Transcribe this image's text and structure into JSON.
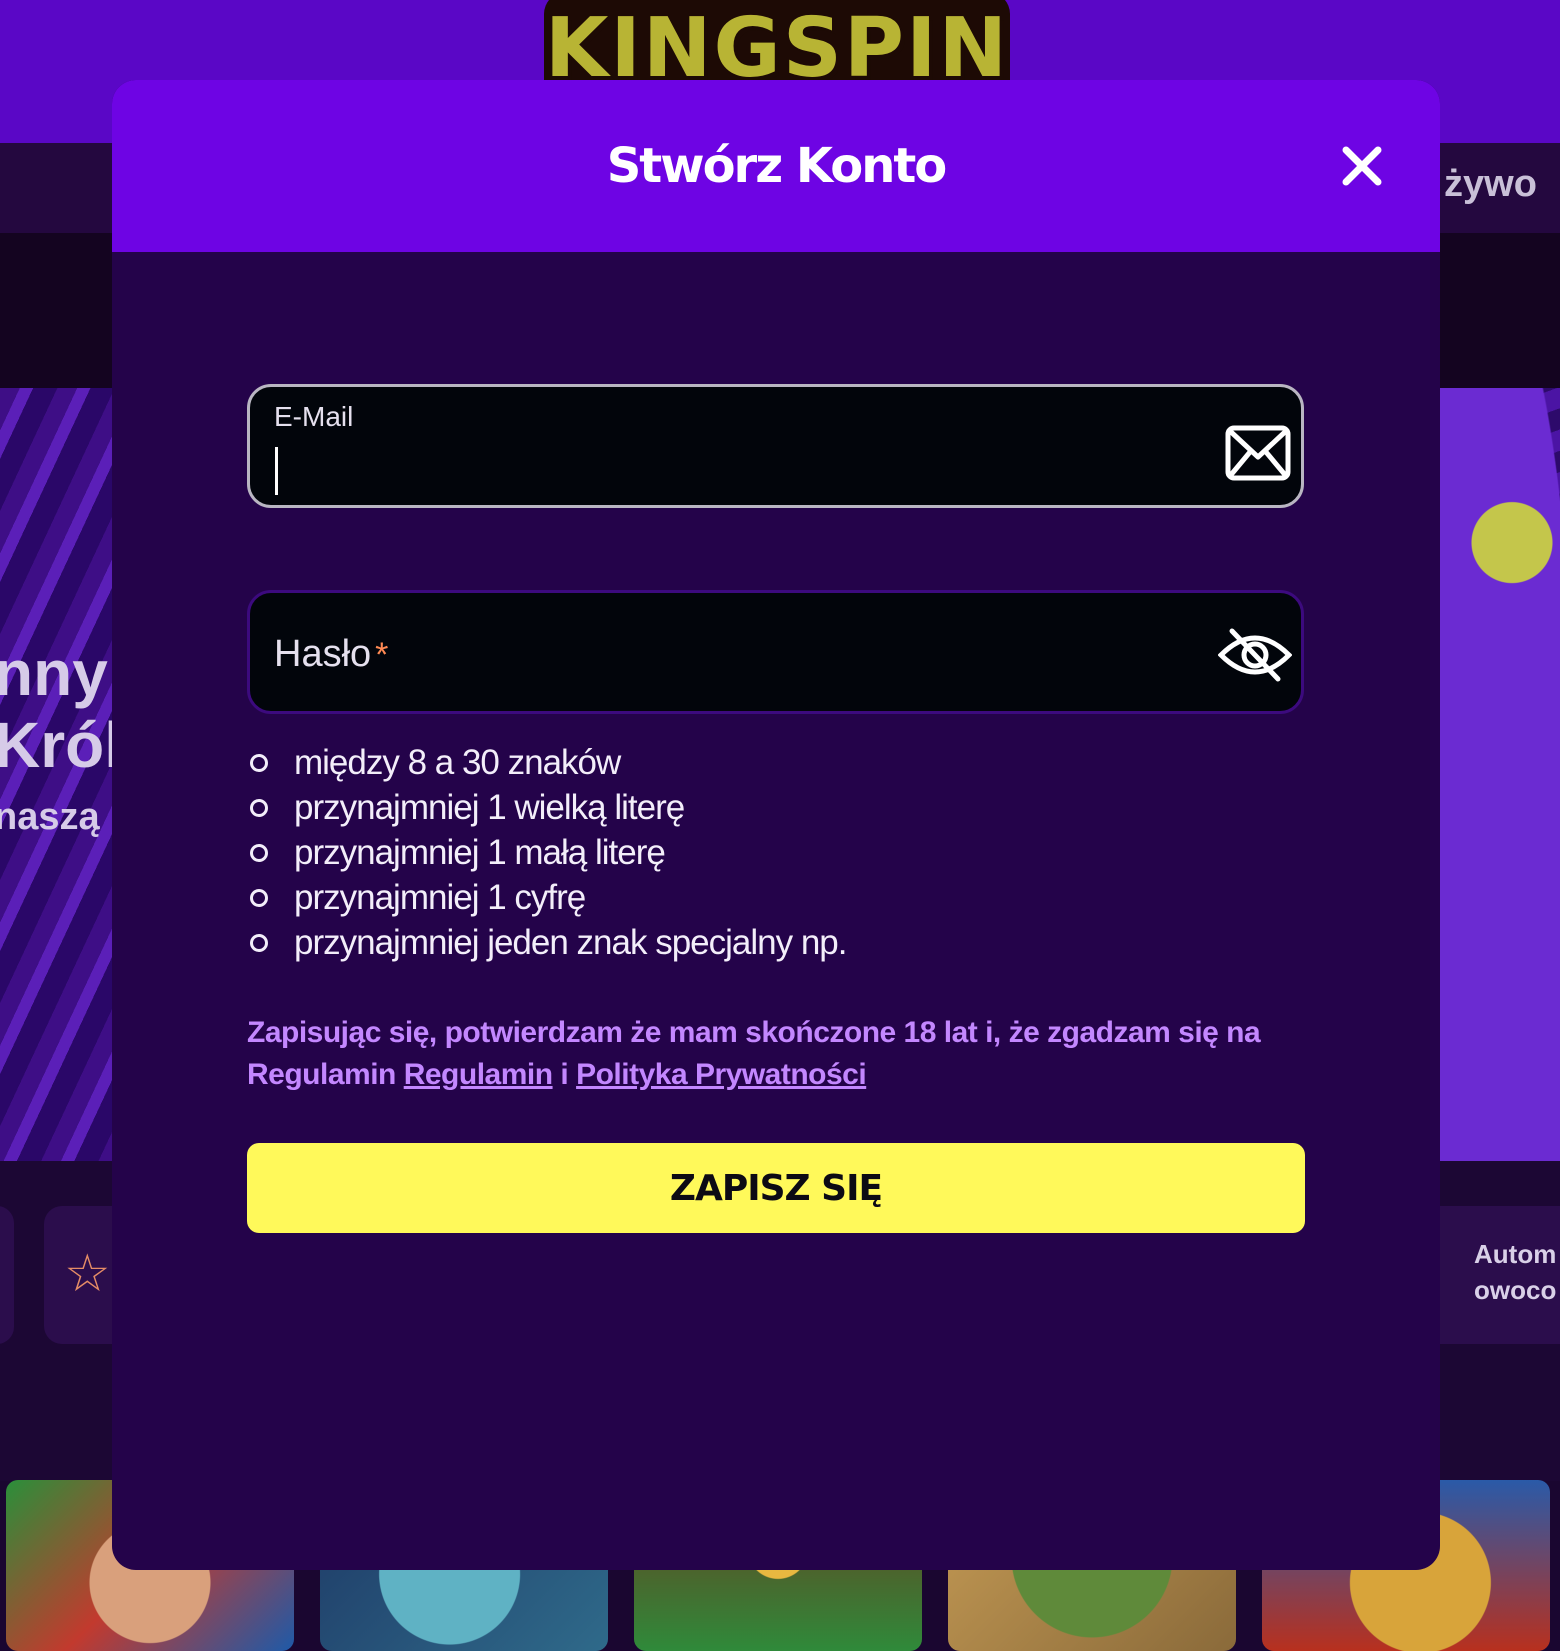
{
  "background": {
    "logo_text": "KINGSPIN",
    "nav_right_text": "żywo",
    "hero_lines": [
      "nny",
      "Król",
      "naszą l"
    ],
    "category_label": [
      "Autom",
      "owoco"
    ],
    "star_icon": "star-icon"
  },
  "modal": {
    "title": "Stwórz Konto",
    "close_icon": "close-icon",
    "email": {
      "label": "E-Mail",
      "value": "",
      "icon": "mail-icon"
    },
    "password": {
      "label": "Hasło",
      "required_mark": "*",
      "icon": "eye-off-icon"
    },
    "requirements": [
      "między 8 a 30 znaków",
      "przynajmniej 1 wielką literę",
      "przynajmniej 1 małą literę",
      "przynajmniej 1 cyfrę",
      "przynajmniej jeden znak specjalny np."
    ],
    "consent": {
      "text_before": "Zapisując się, potwierdzam że mam skończone 18 lat i, że zgadzam się na Regulamin ",
      "terms_link": "Regulamin",
      "conjunction": " i ",
      "privacy_link": "Polityka Prywatności"
    },
    "submit_label": "ZAPISZ SIĘ"
  },
  "colors": {
    "header_purple": "#6e04e4",
    "modal_bg": "#24034a",
    "accent_yellow": "#fff95a",
    "link_purple": "#c387ff",
    "required_orange": "#ff8a54"
  }
}
